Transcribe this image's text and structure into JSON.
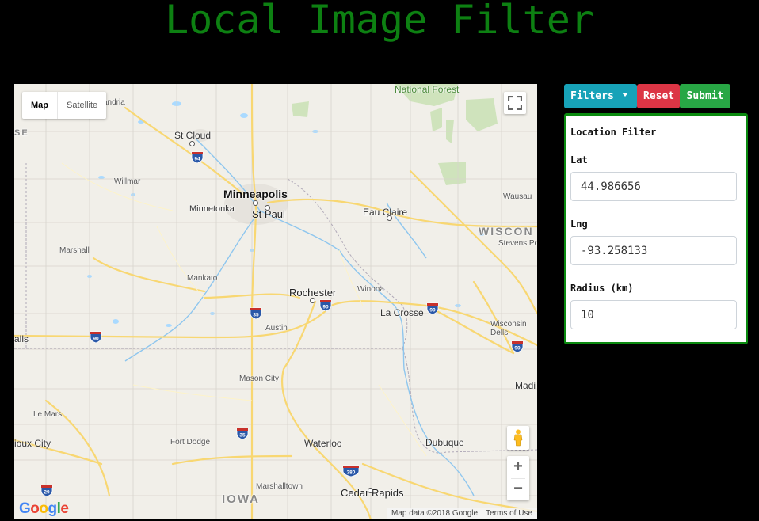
{
  "title": "Local Image Filter",
  "map": {
    "type_tabs": [
      "Map",
      "Satellite"
    ],
    "active_tab": "Map",
    "attribution": "Map data ©2018 Google",
    "terms": "Terms of Use",
    "logo": "Google",
    "zoom_in": "+",
    "zoom_out": "−",
    "labels": {
      "national_forest": "National Forest",
      "andria": "andria",
      "se": "SE",
      "st_cloud": "St Cloud",
      "willmar": "Willmar",
      "minneapolis": "Minneapolis",
      "minnetonka": "Minnetonka",
      "st_paul": "St Paul",
      "eau_claire": "Eau Claire",
      "wausau": "Wausau",
      "wiscon": "WISCON",
      "stevens_po": "Stevens Po",
      "marshall": "Marshall",
      "mankato": "Mankato",
      "rochester": "Rochester",
      "winona": "Winona",
      "la_crosse": "La Crosse",
      "wisconsin_dells": "Wisconsin Dells",
      "austin": "Austin",
      "alls": "alls",
      "mason_city": "Mason City",
      "madi": "Madi",
      "le_mars": "Le Mars",
      "sioux_city": "ioux City",
      "fort_dodge": "Fort Dodge",
      "waterloo": "Waterloo",
      "dubuque": "Dubuque",
      "marshalltown": "Marshalltown",
      "iowa": "IOWA",
      "cedar_rapids": "Cedar Rapids"
    },
    "shields": [
      "94",
      "35",
      "90",
      "90",
      "90",
      "90",
      "35",
      "380",
      "29"
    ]
  },
  "toolbar": {
    "filters_label": "Filters",
    "reset_label": "Reset",
    "submit_label": "Submit"
  },
  "filter_panel": {
    "heading": "Location Filter",
    "lat_label": "Lat",
    "lat_value": "44.986656",
    "lng_label": "Lng",
    "lng_value": "-93.258133",
    "radius_label": "Radius (km)",
    "radius_value": "10"
  },
  "colors": {
    "title": "#0d8012",
    "filters_button": "#17a2b8",
    "reset_button": "#dc3545",
    "submit_button": "#28a745",
    "panel_border": "#0a8a0f"
  }
}
